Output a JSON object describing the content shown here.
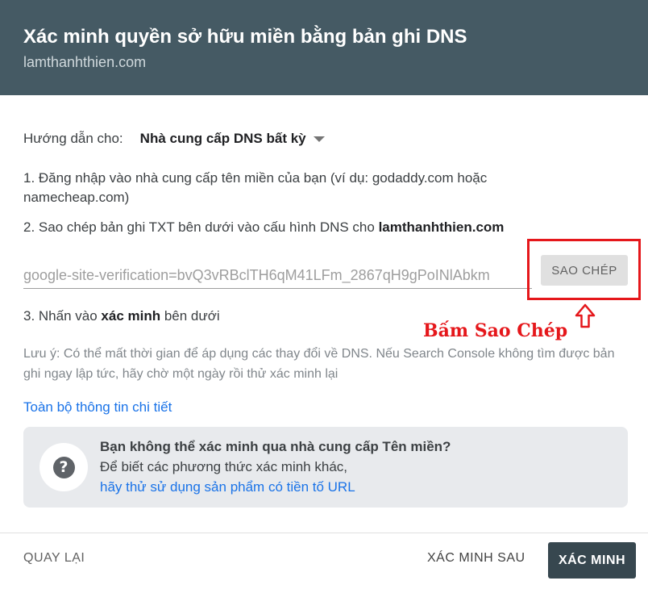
{
  "header": {
    "title": "Xác minh quyền sở hữu miền bằng bản ghi DNS",
    "domain": "lamthanhthien.com"
  },
  "guide": {
    "label": "Hướng dẫn cho:",
    "provider": "Nhà cung cấp DNS bất kỳ"
  },
  "steps": {
    "step1": "1. Đăng nhập vào nhà cung cấp tên miền của bạn (ví dụ: godaddy.com hoặc namecheap.com)",
    "step2_prefix": "2. Sao chép bản ghi TXT bên dưới vào cấu hình DNS cho ",
    "step2_domain": "lamthanhthien.com",
    "step3_prefix": "3. Nhấn vào ",
    "step3_bold": "xác minh",
    "step3_suffix": " bên dưới"
  },
  "txt_record": "google-site-verification=bvQ3vRBclTH6qM41LFm_2867qH9gPoINlAbkm",
  "copy_label": "SAO CHÉP",
  "annotation": "Bấm Sao Chép",
  "note": "Lưu ý: Có thể mất thời gian để áp dụng các thay đổi về DNS. Nếu Search Console không tìm được bản ghi ngay lập tức, hãy chờ một ngày rồi thử xác minh lại",
  "details_link": "Toàn bộ thông tin chi tiết",
  "info": {
    "title": "Bạn không thể xác minh qua nhà cung cấp Tên miền?",
    "description": "Để biết các phương thức xác minh khác,",
    "link": "hãy thử sử dụng sản phẩm có tiền tố URL",
    "icon_glyph": "?"
  },
  "footer": {
    "back": "QUAY LẠI",
    "later": "XÁC MINH SAU",
    "verify": "XÁC MINH"
  },
  "colors": {
    "header_bg": "#455a64",
    "link": "#1a73e8",
    "annotation": "#e5171b",
    "primary_button": "#37474f"
  },
  "icons": {
    "dropdown": "triangle-down",
    "help": "question-circle",
    "annotation_arrow": "outline-up-arrow"
  }
}
